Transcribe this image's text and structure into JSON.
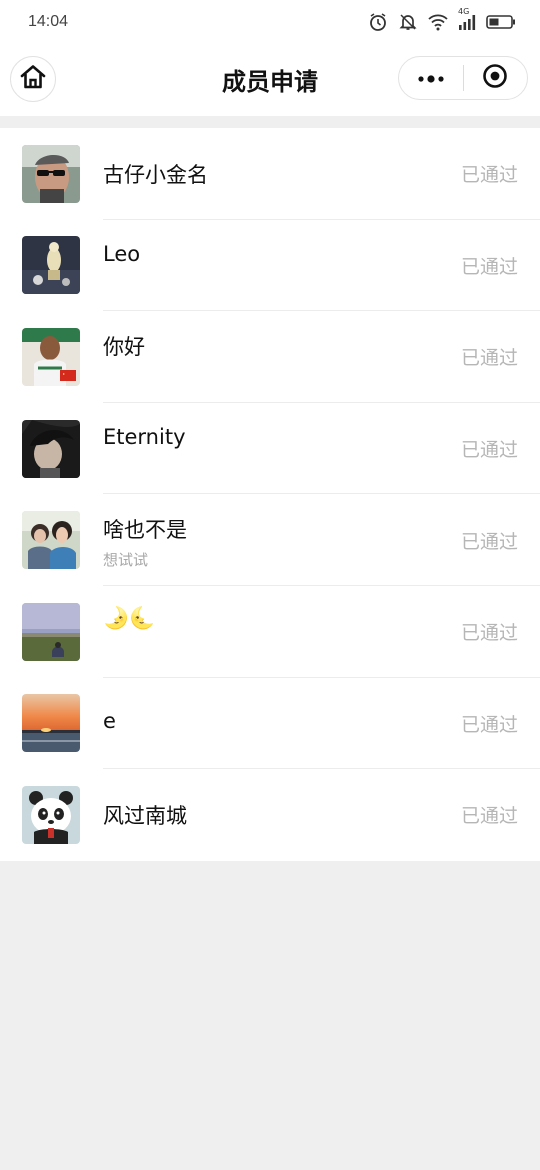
{
  "status_bar": {
    "time": "14:04",
    "network": "4G",
    "icons": [
      "alarm-icon",
      "bell-icon",
      "wifi-icon",
      "signal-icon",
      "battery-icon"
    ]
  },
  "nav": {
    "title": "成员申请",
    "home_icon": "home-icon",
    "more_icon": "more-dots-icon",
    "close_icon": "target-close-icon"
  },
  "members": [
    {
      "name": "古仔小金名",
      "subtitle": "",
      "status": "已通过",
      "avatar": "man-sunglasses"
    },
    {
      "name": "Leo",
      "subtitle": "",
      "status": "已通过",
      "avatar": "figurine-dark"
    },
    {
      "name": "你好",
      "subtitle": "",
      "status": "已通过",
      "avatar": "basketball-player"
    },
    {
      "name": "Eternity",
      "subtitle": "",
      "status": "已通过",
      "avatar": "portrait-dark"
    },
    {
      "name": "啥也不是",
      "subtitle": "想试试",
      "status": "已通过",
      "avatar": "two-girls"
    },
    {
      "name": "🌛🌜",
      "subtitle": "",
      "status": "已通过",
      "avatar": "field-dusk"
    },
    {
      "name": "e",
      "subtitle": "",
      "status": "已通过",
      "avatar": "sunset-sea"
    },
    {
      "name": "风过南城",
      "subtitle": "",
      "status": "已通过",
      "avatar": "panda-cartoon"
    }
  ],
  "colors": {
    "background": "#efefef",
    "card": "#ffffff",
    "status_text": "#b6b6b6",
    "subtitle_text": "#a8a8a8"
  }
}
